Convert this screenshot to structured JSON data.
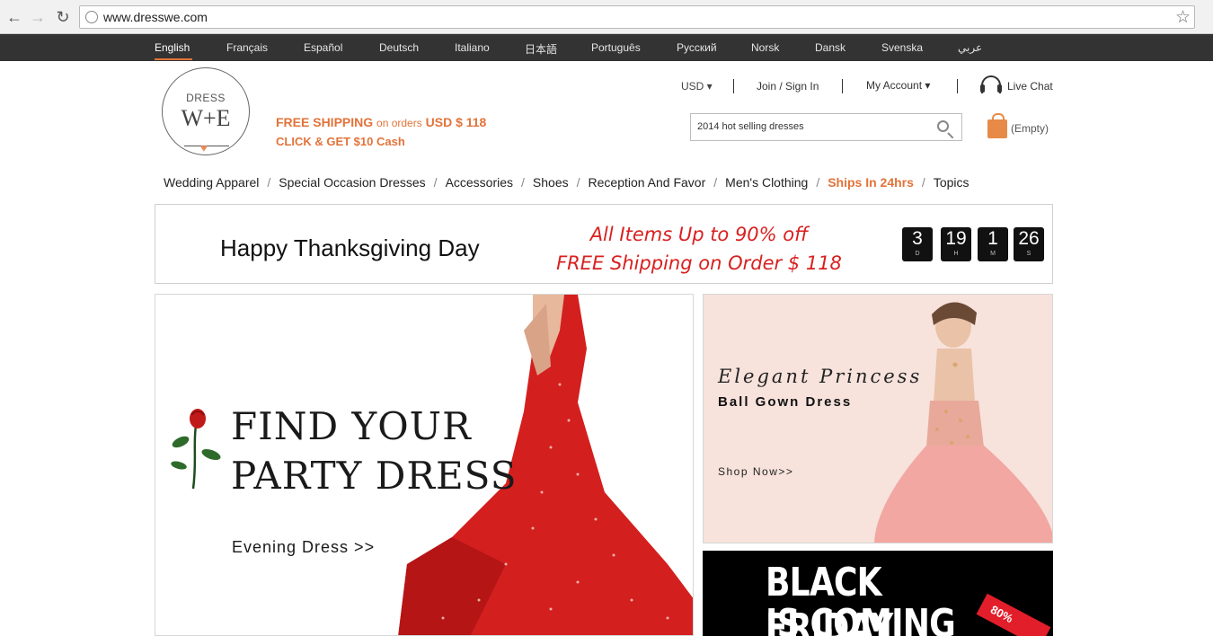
{
  "browser": {
    "url": "www.dresswe.com"
  },
  "languages": [
    "English",
    "Français",
    "Español",
    "Deutsch",
    "Italiano",
    "日本語",
    "Português",
    "Русский",
    "Norsk",
    "Dansk",
    "Svenska",
    "عربي"
  ],
  "active_language": "English",
  "header": {
    "logo_top": "DRESS",
    "logo_main": "W+E",
    "free_shipping": "FREE SHIPPING",
    "on_orders": "on orders",
    "threshold": "USD $  118",
    "cash_promo": "CLICK & GET $10 Cash",
    "currency": "USD",
    "join": "Join / Sign In",
    "account": "My Account",
    "live_chat": "Live Chat",
    "search_value": "2014 hot selling dresses",
    "cart": "(Empty)"
  },
  "categories": [
    {
      "label": "Wedding Apparel"
    },
    {
      "label": "Special Occasion Dresses"
    },
    {
      "label": "Accessories"
    },
    {
      "label": "Shoes"
    },
    {
      "label": "Reception And Favor"
    },
    {
      "label": "Men's Clothing"
    },
    {
      "label": "Ships In 24hrs"
    },
    {
      "label": "Topics"
    }
  ],
  "thanksgiving": {
    "title": "Happy Thanksgiving Day",
    "promo_line1": "All Items Up to 90% off",
    "promo_line2": "FREE Shipping on Order $ 118",
    "countdown": [
      {
        "value": "3",
        "unit": "D"
      },
      {
        "value": "19",
        "unit": "H"
      },
      {
        "value": "1",
        "unit": "M"
      },
      {
        "value": "26",
        "unit": "S"
      }
    ]
  },
  "hero": {
    "line1": "FIND YOUR",
    "line2": "PARTY DRESS",
    "link": "Evening Dress  >>"
  },
  "princess": {
    "title": "Elegant Princess",
    "subtitle": "Ball Gown Dress",
    "link": "Shop Now>>"
  },
  "blackfriday": {
    "line1": "BLACK FRIDAY",
    "line2": "IS COMING",
    "tag": "80%"
  },
  "colors": {
    "accent": "#e2733a",
    "langbar": "#333333",
    "promo_red": "#d92020"
  }
}
